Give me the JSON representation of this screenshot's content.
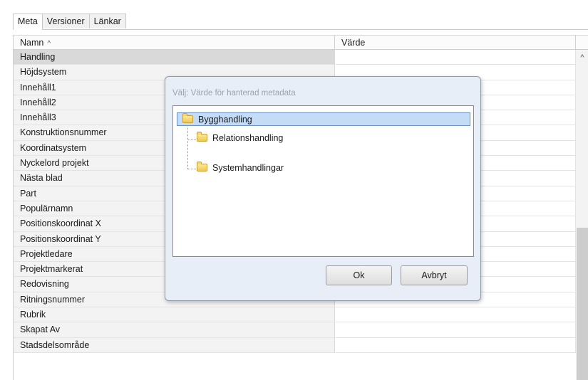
{
  "tabs": [
    "Meta",
    "Versioner",
    "Länkar"
  ],
  "grid": {
    "columns": {
      "name": "Namn",
      "value": "Värde"
    },
    "sort_icon": "sort-up-icon",
    "rows": [
      {
        "name": "Handling",
        "value": ""
      },
      {
        "name": "Höjdsystem",
        "value": ""
      },
      {
        "name": "Innehåll1",
        "value": ""
      },
      {
        "name": "Innehåll2",
        "value": ""
      },
      {
        "name": "Innehåll3",
        "value": ""
      },
      {
        "name": "Konstruktionsnummer",
        "value": ""
      },
      {
        "name": "Koordinatsystem",
        "value": ""
      },
      {
        "name": "Nyckelord projekt",
        "value": ""
      },
      {
        "name": "Nästa blad",
        "value": ""
      },
      {
        "name": "Part",
        "value": ""
      },
      {
        "name": "Populärnamn",
        "value": ""
      },
      {
        "name": "Positionskoordinat X",
        "value": ""
      },
      {
        "name": "Positionskoordinat Y",
        "value": ""
      },
      {
        "name": "Projektledare",
        "value": ""
      },
      {
        "name": "Projektmarkerat",
        "value": ""
      },
      {
        "name": "Redovisning",
        "value": ""
      },
      {
        "name": "Ritningsnummer",
        "value": ""
      },
      {
        "name": "Rubrik",
        "value": ""
      },
      {
        "name": "Skapat Av",
        "value": ""
      },
      {
        "name": "Stadsdelsområde",
        "value": ""
      }
    ]
  },
  "dialog": {
    "title": "Välj: Värde för hanterad metadata",
    "tree": [
      {
        "label": "Bygghandling",
        "selected": true
      },
      {
        "label": "Relationshandling",
        "selected": false
      },
      {
        "label": "Systemhandlingar",
        "selected": false
      }
    ],
    "ok_label": "Ok",
    "cancel_label": "Avbryt"
  },
  "colors": {
    "selection": "#c5dcf6",
    "dialog_bg": "#e7eef7"
  }
}
